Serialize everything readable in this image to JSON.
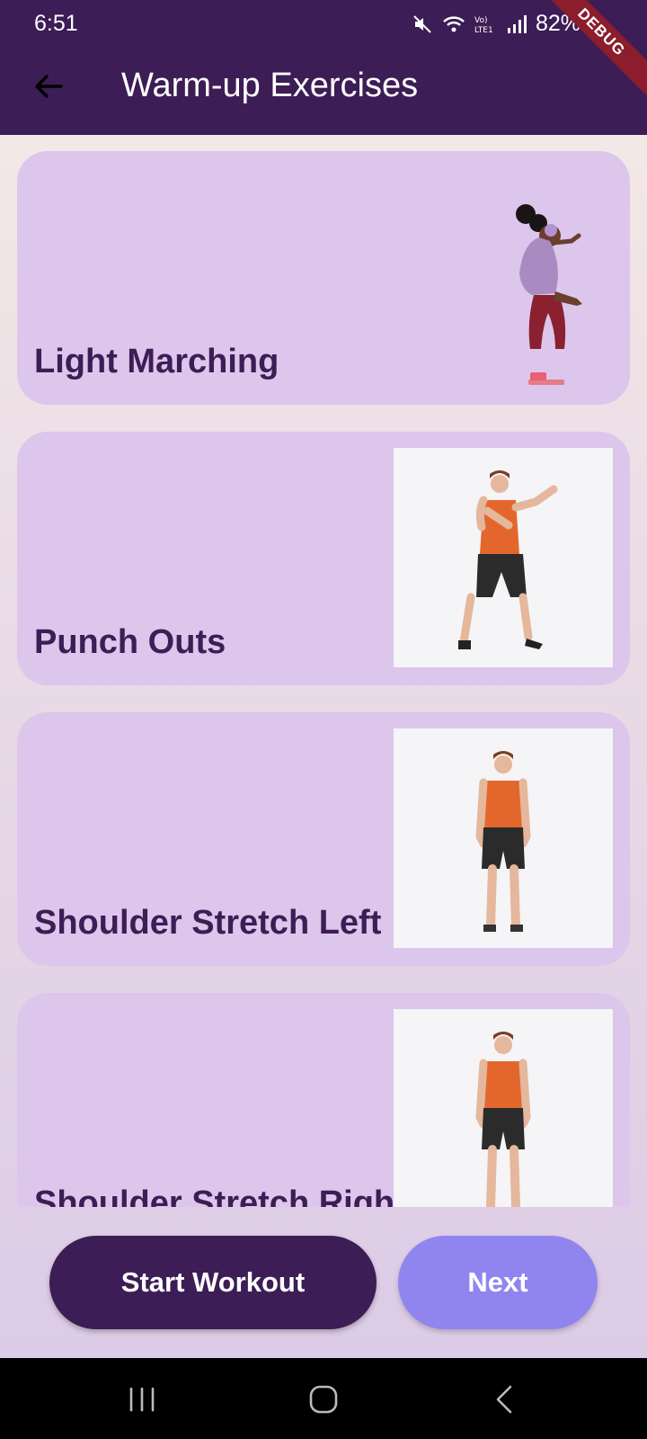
{
  "status": {
    "time": "6:51",
    "battery": "82%",
    "debug": "DEBUG"
  },
  "header": {
    "title": "Warm-up Exercises"
  },
  "exercises": [
    {
      "label": "Light Marching"
    },
    {
      "label": "Punch Outs"
    },
    {
      "label": "Shoulder Stretch Left"
    },
    {
      "label": "Shoulder Stretch Right"
    }
  ],
  "actions": {
    "start_label": "Start Workout",
    "next_label": "Next"
  },
  "colors": {
    "primary": "#3d1d55",
    "card": "#dcc6ec",
    "accent": "#9085ef"
  },
  "icons": {
    "back": "arrow-left-icon",
    "mute": "mute-icon",
    "wifi": "wifi-icon",
    "signal": "signal-icon",
    "battery": "battery-icon"
  }
}
